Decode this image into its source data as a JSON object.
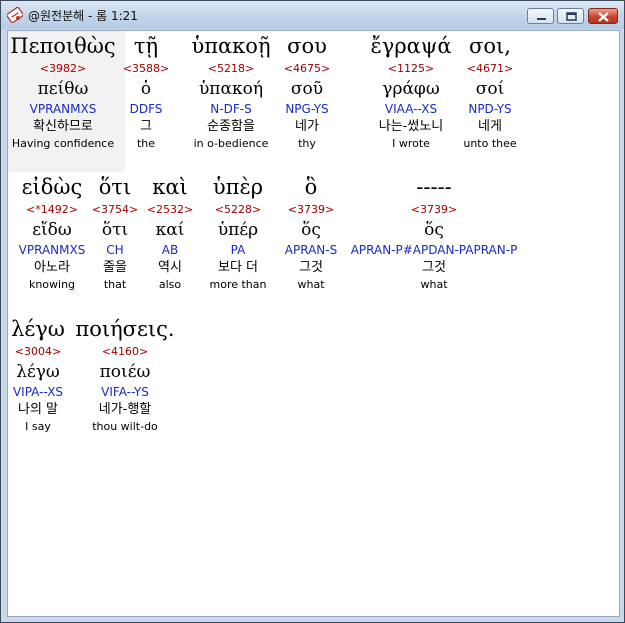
{
  "window": {
    "title": "@원전분해 - 롬 1:21"
  },
  "rows": [
    [
      {
        "greek": "Πεποιθὼς",
        "strong": "<3982>",
        "lemma": "πείθω",
        "parse": "VPRANMXS",
        "korean": "확신하므로",
        "english": "Having confidence"
      },
      {
        "greek": "τῇ",
        "strong": "<3588>",
        "lemma": "ὁ",
        "parse": "DDFS",
        "korean": "그",
        "english": "the"
      },
      {
        "greek": "ὑπακοῇ",
        "strong": "<5218>",
        "lemma": "ὑπακοή",
        "parse": "N-DF-S",
        "korean": "순종함을",
        "english": "in o-bedience"
      },
      {
        "greek": "σου",
        "strong": "<4675>",
        "lemma": "σοῦ",
        "parse": "NPG-YS",
        "korean": "네가",
        "english": "thy"
      },
      {
        "greek": "ἔγραψά",
        "strong": "<1125>",
        "lemma": "γράφω",
        "parse": "VIAA--XS",
        "korean": "나는-썼노니",
        "english": "I wrote"
      },
      {
        "greek": "σοι,",
        "strong": "<4671>",
        "lemma": "σοί",
        "parse": "NPD-YS",
        "korean": "네게",
        "english": "unto thee"
      }
    ],
    [
      {
        "greek": "εἰδὼς",
        "strong": "<*1492>",
        "lemma": "εἴδω",
        "parse": "VPRANMXS",
        "korean": "아노라",
        "english": "knowing"
      },
      {
        "greek": "ὅτι",
        "strong": "<3754>",
        "lemma": "ὅτι",
        "parse": "CH",
        "korean": "줄을",
        "english": "that"
      },
      {
        "greek": "καὶ",
        "strong": "<2532>",
        "lemma": "καί",
        "parse": "AB",
        "korean": "역시",
        "english": "also"
      },
      {
        "greek": "ὑπὲρ",
        "strong": "<5228>",
        "lemma": "ὑπέρ",
        "parse": "PA",
        "korean": "보다 더",
        "english": "more than"
      },
      {
        "greek": "ὃ",
        "strong": "<3739>",
        "lemma": "ὅς",
        "parse": "APRAN-S",
        "korean": "그것",
        "english": "what"
      },
      {
        "greek": "-----",
        "strong": "<3739>",
        "lemma": "ὅς",
        "parse": "APRAN-P#APDAN-PAPRAN-P",
        "korean": "그것",
        "english": "what"
      }
    ],
    [
      {
        "greek": "λέγω",
        "strong": "<3004>",
        "lemma": "λέγω",
        "parse": "VIPA--XS",
        "korean": "나의 말",
        "english": "I say"
      },
      {
        "greek": "ποιήσεις.",
        "strong": "<4160>",
        "lemma": "ποιέω",
        "parse": "VIFA--YS",
        "korean": "네가-행할",
        "english": "thou wilt-do"
      }
    ]
  ]
}
